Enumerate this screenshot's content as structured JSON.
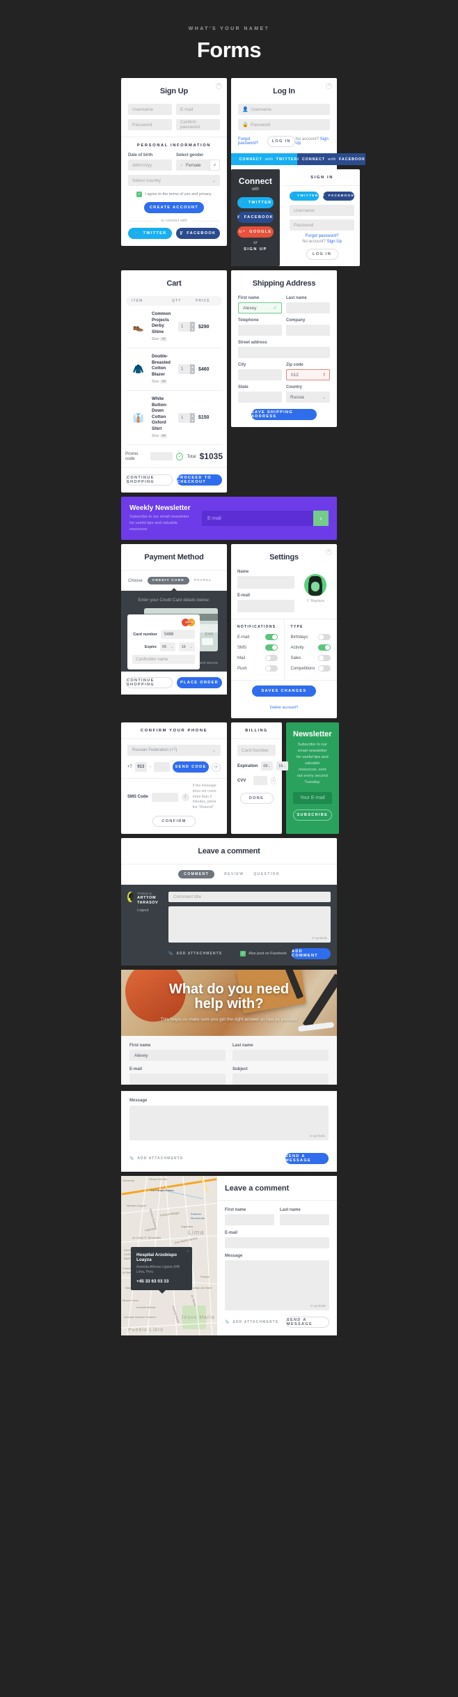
{
  "header": {
    "kicker": "WHAT'S YOUR NAME?",
    "title": "Forms"
  },
  "signup": {
    "title": "Sign Up",
    "close": "×",
    "username_placeholder": "Username",
    "email_placeholder": "E-mail",
    "password_placeholder": "Password",
    "confirm_placeholder": "Confirm password",
    "section_title": "PERSONAL INFORMATION",
    "dob_label": "Date of birth",
    "dob_placeholder": "dd/mm/yy",
    "gender_label": "Select gender",
    "gender_value": "Female",
    "gender_female_icon": "♀",
    "gender_male_icon": "♂",
    "country_placeholder": "Select country",
    "agree_text": "I agree to the terms of use and privacy",
    "create_button": "CREATE ACCOUNT",
    "or_text": "or connect with",
    "twitter": "TWITTER",
    "facebook": "FACEBOOK"
  },
  "login": {
    "title": "Log In",
    "close": "×",
    "username_placeholder": "Username",
    "password_placeholder": "Password",
    "forgot": "Forgot password?",
    "login_button": "LOG IN",
    "no_account": "No account?",
    "signup_link": "Sign Up",
    "connect_twitter_a": "CONNECT",
    "connect_twitter_b": "with",
    "connect_twitter_c": "TWITTER",
    "connect_facebook_c": "FACEBOOK"
  },
  "connect": {
    "title": "Connect",
    "with": "with",
    "twitter": "TWITTER",
    "facebook": "FACEBOOK",
    "google": "GOOGLE",
    "or": "or",
    "signup": "SIGN UP"
  },
  "signin": {
    "title": "SIGN IN",
    "twitter": "TWITTER",
    "facebook": "FACEBOOK",
    "username_placeholder": "Username",
    "password_placeholder": "Password",
    "forgot": "Forgot password?",
    "no_account": "No account?",
    "signup_link": "Sign Up",
    "login_button": "LOG IN"
  },
  "cart": {
    "title": "Cart",
    "col_item": "ITEM",
    "col_qty": "QTY",
    "col_price": "PRICE",
    "items": [
      {
        "name": "Common Projects Derby Shine",
        "size_label": "Size",
        "size": "42",
        "qty": "1",
        "price": "$290",
        "icon": "👞"
      },
      {
        "name": "Double-Breasted Cotton Blazer",
        "size_label": "Size",
        "size": "44",
        "qty": "1",
        "price": "$460",
        "icon": "🧥"
      },
      {
        "name": "White Button-Down Cotton Oxford Shirt",
        "size_label": "Size",
        "size": "44",
        "qty": "1",
        "price": "$150",
        "icon": "👔"
      }
    ],
    "promo_label": "Promo code",
    "promo_ok": "✓",
    "total_label": "Total",
    "total_value": "$1035",
    "continue_button": "CONTINUE SHOPPING",
    "checkout_button": "PROCEED TO CHECKOUT"
  },
  "shipping": {
    "title": "Shipping Address",
    "first_name_label": "First name",
    "first_name_value": "Alexey",
    "valid_icon": "✓",
    "last_name_label": "Last name",
    "telephone_label": "Telephone",
    "company_label": "Company",
    "street_label": "Street address",
    "city_label": "City",
    "zip_label": "Zip code",
    "zip_value": "012",
    "error_icon": "!",
    "state_label": "State",
    "country_label": "Country",
    "country_value": "Russia",
    "save_button": "SAVE SHIPPING ADDRESS"
  },
  "newsletter_banner": {
    "title": "Weekly Newsletter",
    "subtitle": "Subscribe to our email newsletter for useful tips and valuable resources",
    "email_placeholder": "E-mail",
    "go_icon": "›"
  },
  "payment": {
    "title": "Payment Method",
    "choose_label": "Choose",
    "credit_card": "CREDIT CARD",
    "paypal": "PAYPAL",
    "caption": "Enter your Credit Card details below:",
    "card_number_label": "Card number",
    "card_number_value": "5486",
    "expire_label": "Expire",
    "expire_month": "05",
    "expire_year": "16",
    "holder_placeholder": "Cardholder name",
    "cvv_label": "CVV",
    "brand": "MasterCard",
    "safe_text": "Ordering with our store is 100% safe and secure",
    "lock_icon": "🔒",
    "continue_button": "CONTINUE SHOPPING",
    "place_button": "PLACE ORDER"
  },
  "settings": {
    "title": "Settings",
    "close": "×",
    "name_label": "Name",
    "email_label": "E-mail",
    "replace": "Replace",
    "notifications_title": "NOTIFICATIONS",
    "type_title": "TYPE",
    "notifications": [
      {
        "label": "E-mail",
        "on": true
      },
      {
        "label": "SMS",
        "on": true
      },
      {
        "label": "Mail",
        "on": false
      },
      {
        "label": "Push",
        "on": false
      }
    ],
    "types": [
      {
        "label": "Birthdays",
        "on": false
      },
      {
        "label": "Activity",
        "on": true
      },
      {
        "label": "Sales",
        "on": false
      },
      {
        "label": "Competitions",
        "on": false
      }
    ],
    "save_button": "SAVES CHANGES",
    "delete_link": "Delete account?"
  },
  "confirm_phone": {
    "title": "CONFIRM YOUR PHONE",
    "country_value": "Russian Federation (+7)",
    "country_code": "+7",
    "area_code": "913",
    "dash": "-",
    "send_button": "SEND CODE",
    "resend_icon": "⟳",
    "sms_label": "SMS Code",
    "info_icon": "i",
    "hint": "If the message does not come more than 3 minutes, press the \"Resend\"",
    "confirm_button": "CONFIRM"
  },
  "billing": {
    "title": "BILLING",
    "card_placeholder": "Card Number",
    "expiration_label": "Expiration",
    "expiration_month": "05",
    "expiration_year": "16",
    "cvv_label": "CVV",
    "info_icon": "i",
    "done_button": "DONE"
  },
  "green_newsletter": {
    "title": "Newsletter",
    "body": "Subscribe to our email newsletter for useful tips and valuable resources, sent out every second Tuesday.",
    "email_placeholder": "Your E-mail",
    "subscribe_button": "SUBSCRIBE"
  },
  "comment": {
    "title": "Leave a comment",
    "tabs": [
      "COMMENT",
      "REVIEW",
      "QUESTION"
    ],
    "posting_as": "Posting as",
    "user_name": "ARTYOM TARASOV",
    "logout": "Logout",
    "title_placeholder": "Comment title",
    "symbols": "0 symbols",
    "attachments": "ADD ATTACHMENTS",
    "attach_icon": "📎",
    "facebook_check": "Also post on Facebook",
    "add_button": "ADD COMMENT"
  },
  "hero": {
    "heading_line1": "What do you need",
    "heading_line2": "help with?",
    "subtitle": "This helps us make sure you get the right answer as fast as possible",
    "first_name_label": "First name",
    "first_name_value": "Alexey",
    "last_name_label": "Last name",
    "email_label": "E-mail",
    "subject_label": "Subject",
    "message_label": "Message",
    "symbols": "0 symbols",
    "attachments": "ADD ATTACHMENTS",
    "send_button": "SEND A MESSAGE"
  },
  "map_section": {
    "popup_title": "Hospital Arzobispo Loayza",
    "popup_address_line1": "Avenida Alfonso Ugarte 848",
    "popup_address_line2": "Lima, Peru",
    "popup_phone": "+45 33 63 03 33",
    "popup_close": "×",
    "map_labels": [
      "Horizonte",
      "Piedra Del Rio",
      "Via Parque Rimac",
      "Mariano Angulo",
      "Nicolas Duenas",
      "Enrique Meiggs",
      "Estacion Monserrate",
      "Argentina",
      "Av Oscar R. Benavides",
      "Jose Maria Zamtoz",
      "ELEAZAR GUZMAN BARRON",
      "Francisca la Mariana",
      "Mariano Cornejo",
      "Museo Larco",
      "Avenida Bolivar",
      "Avenida General Clement",
      "El Campo de Marte",
      "Av Colombia",
      "Av Tacna",
      "Avenida Brasil",
      "Parque"
    ],
    "map_big_labels": [
      "Lima",
      "Jesus Maria",
      "Pueblo Libre"
    ],
    "form_title": "Leave a comment",
    "first_name_label": "First name",
    "last_name_label": "Last name",
    "email_label": "E-mail",
    "message_label": "Message",
    "symbols": "0 symbols",
    "attachments": "ADD ATTACHMENTS",
    "send_button": "SEND A MESSAGE"
  },
  "colors": {
    "background": "#232323",
    "blue": "#2f6ded",
    "twitter": "#18aff2",
    "facebook": "#2a4b8d",
    "google": "#e8513b",
    "green": "#5cc47c",
    "purple": "#6d3ce8",
    "dark": "#3a3f45",
    "error": "#e8725f"
  }
}
